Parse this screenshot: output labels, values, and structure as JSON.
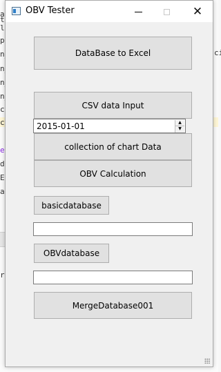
{
  "window": {
    "title": "OBV Tester",
    "minimize_glyph": "",
    "close_glyph": "✕"
  },
  "buttons": {
    "db_to_excel": "DataBase to Excel",
    "csv_input": "CSV data Input",
    "collect_chart": "collection of chart Data",
    "obv_calc": "OBV Calculation",
    "basic_db": "basicdatabase",
    "obv_db": "OBVdatabase",
    "merge_db": "MergeDatabase001"
  },
  "date_picker": {
    "value": "2015-01-01",
    "up_glyph": "▲",
    "down_glyph": "▼"
  },
  "fields": {
    "basic_db_value": "",
    "obv_db_value": ""
  },
  "background_editor": {
    "lines": [
      "at",
      "ta",
      "la",
      "pl",
      "n_",
      "n_",
      "n_",
      "ce",
      "c.",
      "el",
      "da",
      "Ed",
      "at",
      "ri"
    ],
    "right_fragment": "ci"
  },
  "colors": {
    "window_bg": "#f0f0f0",
    "button_face": "#e1e1e1",
    "button_border": "#adadad"
  }
}
